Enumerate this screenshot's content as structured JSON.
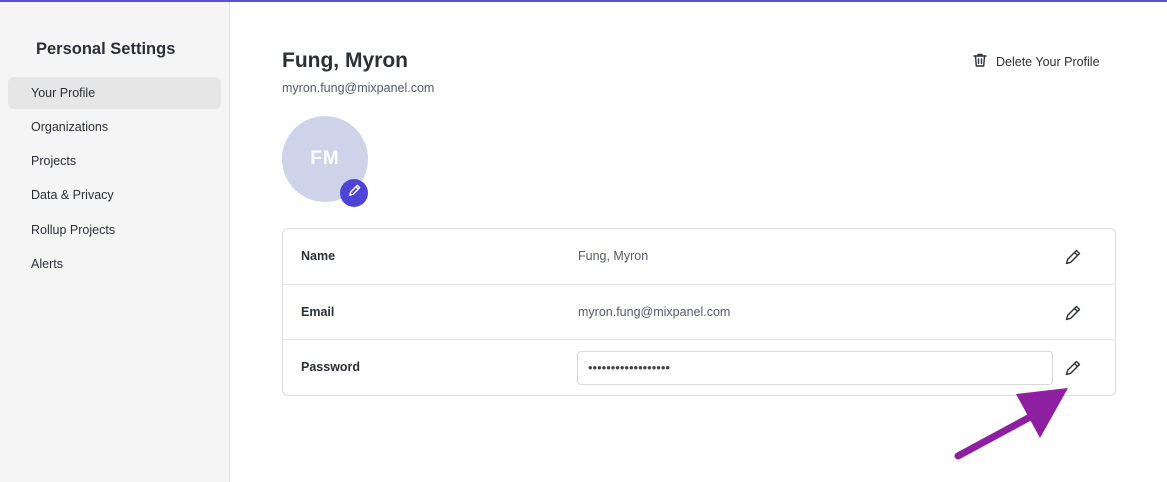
{
  "sidebar": {
    "title": "Personal Settings",
    "items": [
      {
        "label": "Your Profile",
        "active": true
      },
      {
        "label": "Organizations"
      },
      {
        "label": "Projects"
      },
      {
        "label": "Data & Privacy"
      },
      {
        "label": "Rollup Projects"
      },
      {
        "label": "Alerts"
      }
    ]
  },
  "profile": {
    "name": "Fung, Myron",
    "email": "myron.fung@mixpanel.com",
    "initials": "FM",
    "delete_label": "Delete Your Profile"
  },
  "fields": [
    {
      "label": "Name",
      "value": "Fung, Myron"
    },
    {
      "label": "Email",
      "value": "myron.fung@mixpanel.com"
    },
    {
      "label": "Password",
      "value": "••••••••••••••••••"
    }
  ],
  "colors": {
    "accent": "#4f44d8",
    "avatar_bg": "#cdd4ea",
    "annotation_arrow": "#8e1fa0"
  },
  "icons": {
    "delete": "trash-icon",
    "edit": "pencil-icon"
  }
}
